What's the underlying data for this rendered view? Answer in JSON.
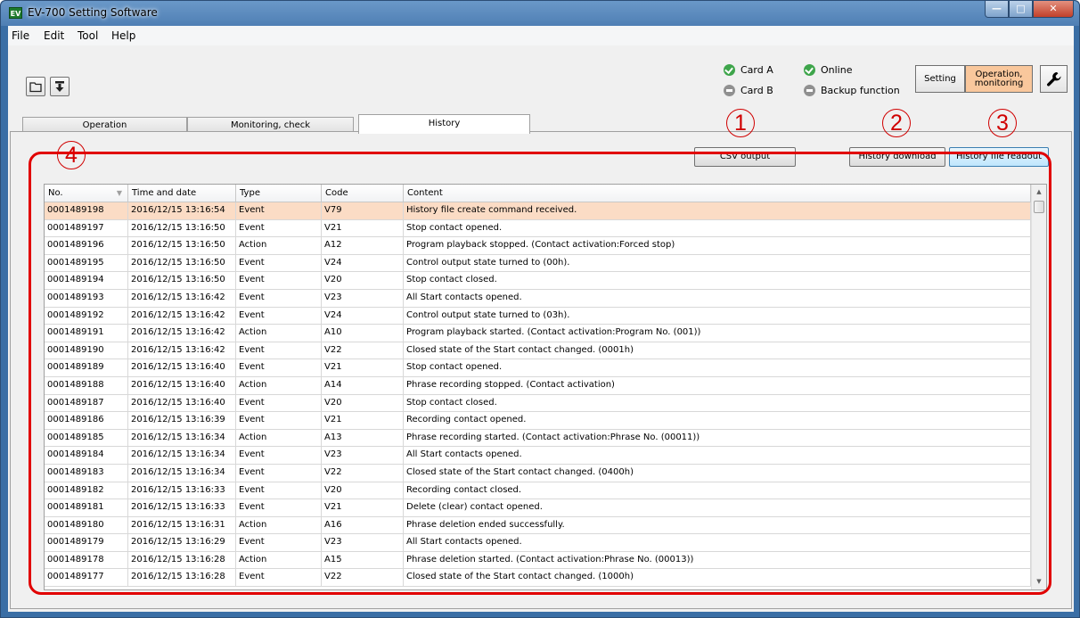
{
  "window": {
    "title": "EV-700 Setting Software",
    "app_icon": "EV"
  },
  "menu": [
    "File",
    "Edit",
    "Tool",
    "Help"
  ],
  "toolbar": {
    "open_icon": "folder-icon",
    "download_icon": "download-icon"
  },
  "status": {
    "card_a": "Card A",
    "card_b": "Card B",
    "online": "Online",
    "backup": "Backup function"
  },
  "mode": {
    "setting": "Setting",
    "operation_line1": "Operation,",
    "operation_line2": "monitoring",
    "tool_icon": "wrench-icon"
  },
  "tabs": [
    "Operation",
    "Monitoring, check",
    "History"
  ],
  "buttons": {
    "csv": "CSV output",
    "download": "History download",
    "readout": "History file readout"
  },
  "callouts": [
    "1",
    "2",
    "3",
    "4"
  ],
  "colors": {
    "callout": "#d00000",
    "selected_row": "#fbdcc5",
    "active_mode": "#f9c79c"
  },
  "table": {
    "headers": [
      "No.",
      "Time and date",
      "Type",
      "Code",
      "Content"
    ],
    "rows": [
      [
        "0001489198",
        "2016/12/15 13:16:54",
        "Event",
        "V79",
        "History file create command received."
      ],
      [
        "0001489197",
        "2016/12/15 13:16:50",
        "Event",
        "V21",
        "Stop contact opened."
      ],
      [
        "0001489196",
        "2016/12/15 13:16:50",
        "Action",
        "A12",
        "Program playback stopped. (Contact activation:Forced stop)"
      ],
      [
        "0001489195",
        "2016/12/15 13:16:50",
        "Event",
        "V24",
        "Control output state turned to (00h)."
      ],
      [
        "0001489194",
        "2016/12/15 13:16:50",
        "Event",
        "V20",
        "Stop contact closed."
      ],
      [
        "0001489193",
        "2016/12/15 13:16:42",
        "Event",
        "V23",
        "All Start contacts opened."
      ],
      [
        "0001489192",
        "2016/12/15 13:16:42",
        "Event",
        "V24",
        "Control output state turned to (03h)."
      ],
      [
        "0001489191",
        "2016/12/15 13:16:42",
        "Action",
        "A10",
        "Program playback started. (Contact activation:Program No. (001))"
      ],
      [
        "0001489190",
        "2016/12/15 13:16:42",
        "Event",
        "V22",
        "Closed state of the Start contact changed.  (0001h)"
      ],
      [
        "0001489189",
        "2016/12/15 13:16:40",
        "Event",
        "V21",
        "Stop contact opened."
      ],
      [
        "0001489188",
        "2016/12/15 13:16:40",
        "Action",
        "A14",
        "Phrase recording stopped. (Contact activation)"
      ],
      [
        "0001489187",
        "2016/12/15 13:16:40",
        "Event",
        "V20",
        "Stop contact closed."
      ],
      [
        "0001489186",
        "2016/12/15 13:16:39",
        "Event",
        "V21",
        "Recording contact opened."
      ],
      [
        "0001489185",
        "2016/12/15 13:16:34",
        "Action",
        "A13",
        "Phrase recording started. (Contact activation:Phrase No. (00011))"
      ],
      [
        "0001489184",
        "2016/12/15 13:16:34",
        "Event",
        "V23",
        "All Start contacts opened."
      ],
      [
        "0001489183",
        "2016/12/15 13:16:34",
        "Event",
        "V22",
        "Closed state of the Start contact changed.  (0400h)"
      ],
      [
        "0001489182",
        "2016/12/15 13:16:33",
        "Event",
        "V20",
        "Recording contact closed."
      ],
      [
        "0001489181",
        "2016/12/15 13:16:33",
        "Event",
        "V21",
        "Delete (clear) contact opened."
      ],
      [
        "0001489180",
        "2016/12/15 13:16:31",
        "Action",
        "A16",
        "Phrase deletion ended successfully."
      ],
      [
        "0001489179",
        "2016/12/15 13:16:29",
        "Event",
        "V23",
        "All Start contacts opened."
      ],
      [
        "0001489178",
        "2016/12/15 13:16:28",
        "Action",
        "A15",
        "Phrase deletion started. (Contact activation:Phrase No. (00013))"
      ],
      [
        "0001489177",
        "2016/12/15 13:16:28",
        "Event",
        "V22",
        "Closed state of the Start contact changed.  (1000h)"
      ]
    ]
  }
}
